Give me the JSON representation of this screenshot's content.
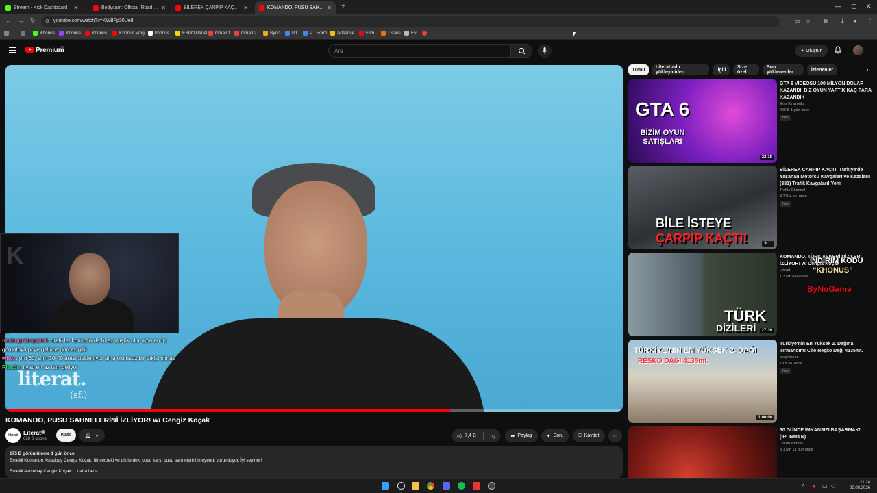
{
  "browser": {
    "tabs": [
      {
        "label": "Stream - Kick Dashboard",
        "color": "#53fc18",
        "active": false
      },
      {
        "label": "Bodycam: Official 'Road to Los'",
        "color": "#ff0000",
        "active": false
      },
      {
        "label": "BİLEREK ÇARPIP KAÇTI! Türkiye'",
        "color": "#ff0000",
        "active": false
      },
      {
        "label": "KOMANDO, PUSU SAHNELERİN",
        "color": "#ff0000",
        "active": true
      }
    ],
    "url": "youtube.com/watch?v=KWBFp30Ue8",
    "bookmarks": [
      {
        "label": "Khonus",
        "color": "#53fc18"
      },
      {
        "label": "Khonus",
        "color": "#9146ff"
      },
      {
        "label": "Khonus",
        "color": "#ff0000"
      },
      {
        "label": "Khonus Vlog",
        "color": "#ff0000"
      },
      {
        "label": "khonus",
        "color": "#ffffff"
      },
      {
        "label": "ESPO Panel",
        "color": "#ffd400"
      },
      {
        "label": "Gmail 1",
        "color": "#ea4335"
      },
      {
        "label": "Gmail 2",
        "color": "#ea4335"
      },
      {
        "label": "Byno",
        "color": "#f5a623"
      },
      {
        "label": "PT",
        "color": "#4285f4"
      },
      {
        "label": "PT Form",
        "color": "#4285f4"
      },
      {
        "label": "Adsense",
        "color": "#fbbc04"
      },
      {
        "label": "Film",
        "color": "#e50914"
      },
      {
        "label": "Lisans",
        "color": "#ff6d00"
      },
      {
        "label": "Ev",
        "color": "#bbbbbb"
      }
    ]
  },
  "youtube": {
    "brand": "Premium",
    "country": "TR",
    "search_placeholder": "Ara",
    "create_label": "Oluştur"
  },
  "player": {
    "progress": 0.72,
    "chat": [
      {
        "user": "",
        "text": "....."
      },
      {
        "user": "nesbugrabagdinli",
        "text": ": grafikler konsollarda biraz düşük olur ama en iyi görüntüyü pcye gelince görcez gibi"
      },
      {
        "user": "whox",
        "text": ": pro 60, slim 30-40 arası bekleniyor ama olumsuz bir etkisi olmaz"
      },
      {
        "user": "Plasdo",
        "text": ": fiyatı en az tam geliyor"
      }
    ],
    "watermark": "literat.",
    "watermark_sub": "(sf.)"
  },
  "video": {
    "title": "KOMANDO, PUSU SAHNELERİNİ İZLİYOR! w/ Cengiz Koçak",
    "channel": "Literat",
    "channel_avatar": "literat",
    "subscribers": "628 B abone",
    "join_label": "Katıl",
    "likes": "7,4 B",
    "share_label": "Paylaş",
    "ask_label": "Soru",
    "save_label": "Kaydet",
    "stats": "175 B görüntüleme  1 gün önce",
    "description_1": "Emekli Komando Astsubay Cengiz Koçak, filmlerdeki ve dizilerdeki pusu karşı pusu sahnelerini izleyerek yorumluyor. İyi seyirler!",
    "description_2": "Emekli Astsubay Cengiz Koçak: ...daha fazla"
  },
  "chips": [
    "Tümü",
    "Literat adlı yükleyiciden",
    "İlgili",
    "Size özel",
    "Son yüklenenler",
    "İzlenenler"
  ],
  "recommendations": [
    {
      "title": "GTA 6 VİDEOSU 100 MİLYON DOLAR KAZANDI, BİZ OYUN YAPTIK KAÇ PARA KAZANDIK",
      "channel": "Enis Kirazoğlu",
      "meta": "405 B  1 gün önce",
      "badge": "Yeni",
      "duration": "22:18",
      "thumb_text": "GTA 6",
      "thumb_text2": "BİZİM OYUN SATIŞLARI"
    },
    {
      "title": "BİLEREK ÇARPIP KAÇTI! Türkiye'de Yaşanan Motorcu Kavgaları ve Kazaları! (381) Trafik Kavgaları! Yeni",
      "channel": "Traffic Channel",
      "meta": "4,3 B  4 sa. önce",
      "badge": "Yeni",
      "duration": "9:11",
      "thumb_text": "BİLE İSTEYE",
      "thumb_text2": "ÇARPIP KAÇTI!"
    },
    {
      "title": "KOMANDO, TÜRK ASKERİ DİZİLERİ İZLİYOR! w/ Cengiz Koçak",
      "channel": "Literat",
      "meta": "1,3 Mn  4 ay önce",
      "badge": "",
      "duration": "27:39",
      "thumb_text": "TÜRK",
      "thumb_text2": "DİZİLERİ"
    },
    {
      "title": "Türkiye'nin En Yüksek 2. Dağına Tırmandım! Cilo Reşko Dağı 4135mt.",
      "channel": "six pictures",
      "meta": "79  8 sa. önce",
      "badge": "Yeni",
      "duration": "1:00:00",
      "thumb_text": "TÜRKİYE'NİN EN YÜKSEK 2. DAĞI",
      "thumb_text2": "REŞKO DAĞI 4135mt."
    },
    {
      "title": "30 GÜNDE İMKANSIZI BAŞARMAK! (IRONMAN)",
      "channel": "Orkun Işıtmak",
      "meta": "3,1 Mn  13 gün önce",
      "badge": "",
      "duration": "",
      "thumb_text": "",
      "thumb_text2": ""
    }
  ],
  "promo": {
    "line1": "İNDİRİM KODU",
    "line2": "“KHONUS”",
    "line3": "ByNoGame"
  },
  "taskbar": {
    "time": "21:24",
    "date": "20.08.2026"
  }
}
